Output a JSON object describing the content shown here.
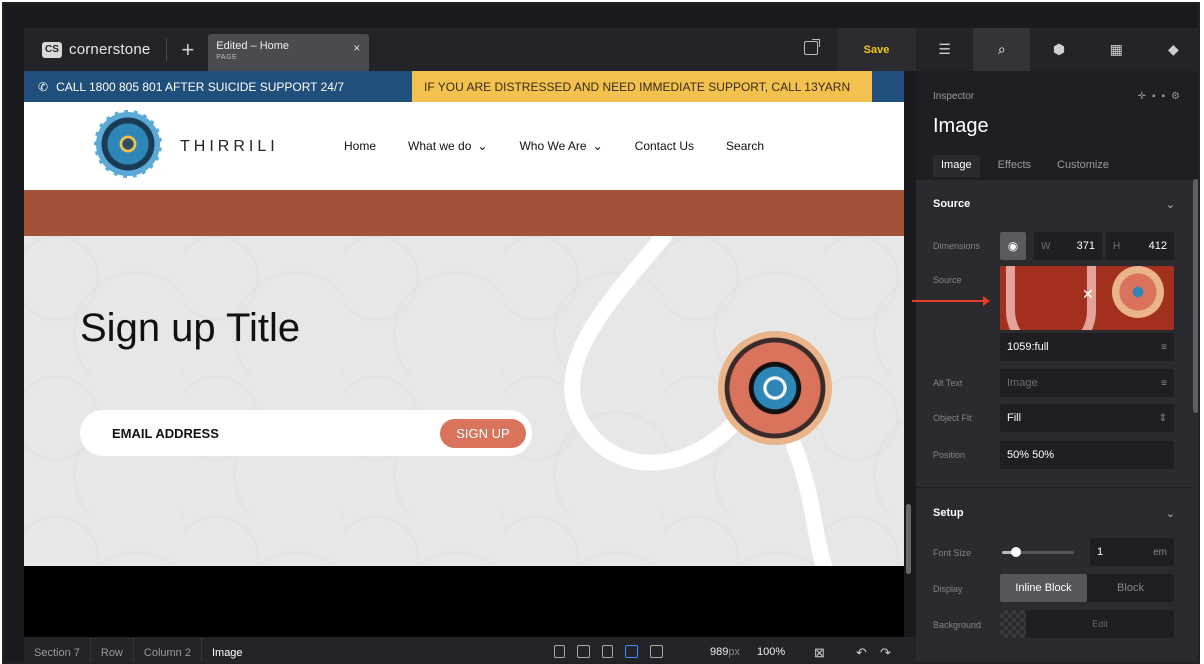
{
  "app": {
    "logo_mark": "CS",
    "name": "cornerstone",
    "add_label": "+",
    "tab": {
      "title": "Edited – Home",
      "subtitle": "PAGE",
      "close": "×"
    },
    "save_label": "Save"
  },
  "panel_icons": [
    "layers-icon",
    "search-icon",
    "elements-icon",
    "layout-icon",
    "stack-icon"
  ],
  "site": {
    "alert_left": "CALL 1800 805 801 AFTER SUICIDE SUPPORT 24/7",
    "alert_right": "IF YOU ARE DISTRESSED AND NEED IMMEDIATE SUPPORT, CALL 13YARN",
    "name": "THIRRILI",
    "nav": [
      "Home",
      "What we do",
      "Who We Are",
      "Contact Us",
      "Search"
    ],
    "hero_title": "Sign up Title",
    "email_label": "EMAIL ADDRESS",
    "signup_label": "SIGN UP"
  },
  "breadcrumbs": [
    "Section 7",
    "Row",
    "Column 2",
    "Image"
  ],
  "viewport": {
    "width_value": "989",
    "width_unit": "px",
    "zoom": "100%"
  },
  "inspector": {
    "label": "Inspector",
    "title": "Image",
    "tabs": [
      "Image",
      "Effects",
      "Customize"
    ],
    "source_section": "Source",
    "dimensions_label": "Dimensions",
    "w_label": "W",
    "w_value": "371",
    "h_label": "H",
    "h_value": "412",
    "source_label": "Source",
    "image_size": "1059:full",
    "alt_label": "Alt Text",
    "alt_placeholder": "Image",
    "object_fit_label": "Object Fit",
    "object_fit_value": "Fill",
    "position_label": "Position",
    "position_value": "50% 50%",
    "setup_section": "Setup",
    "font_size_label": "Font Size",
    "font_size_value": "1",
    "font_size_unit": "em",
    "font_size_slider_fraction": 0.2,
    "display_label": "Display",
    "display_options": [
      "Inline Block",
      "Block"
    ],
    "display_selected": "Inline Block",
    "background_label": "Background",
    "background_edit": "Edit"
  },
  "colors": {
    "accent_save": "#f5c518",
    "alert_blue": "#1f4f7a",
    "alert_yellow": "#f2c14e",
    "brand_brown": "#a35139",
    "signup_orange": "#d9735b",
    "active_device": "#3a8dff"
  }
}
